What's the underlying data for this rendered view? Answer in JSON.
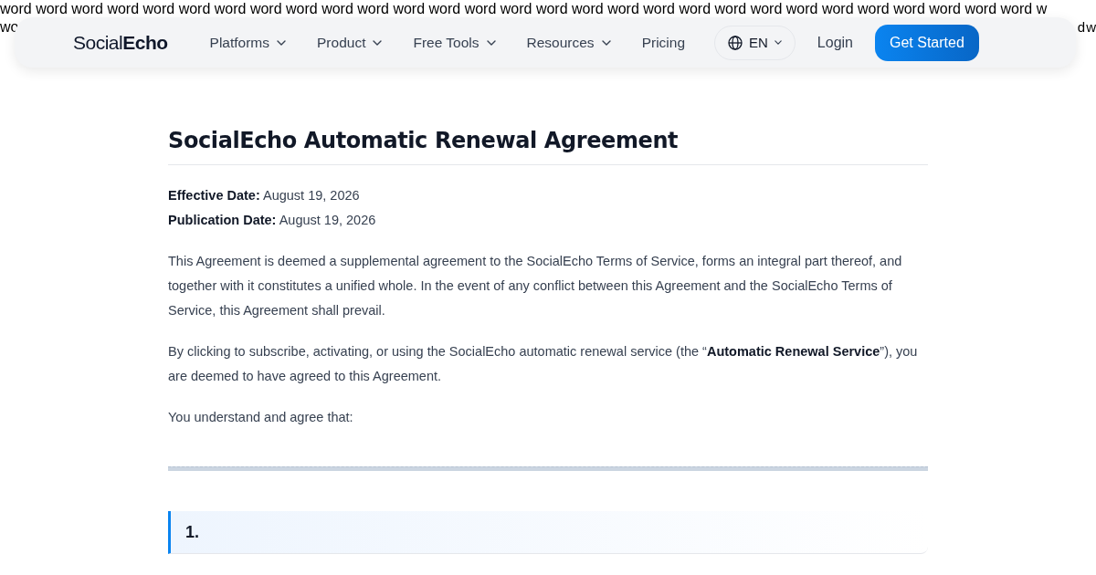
{
  "background_text": {
    "line_1": "word word word word word word word word word word word word word word word word word word word word word word word word word word word word word w",
    "line_2_left": "wo",
    "line_2_right": "d w"
  },
  "header": {
    "logo": "Social**Echo**",
    "nav": [
      {
        "label": "Platforms",
        "dropdown": true
      },
      {
        "label": "Product",
        "dropdown": true
      },
      {
        "label": "Free Tools",
        "dropdown": true
      },
      {
        "label": "Resources",
        "dropdown": true
      },
      {
        "label": "Pricing",
        "dropdown": false
      }
    ],
    "language": "EN",
    "login": "Login",
    "cta": "Get Started"
  },
  "document": {
    "title": "SocialEcho Automatic Renewal Agreement",
    "meta": [
      "**Effective Date:** August 19, 2026",
      "**Publication Date:** August 19, 2026"
    ],
    "paragraphs": [
      "This Agreement is deemed a supplemental agreement to the SocialEcho Terms of Service, forms an integral part thereof, and together with it constitutes a unified whole. In the event of any conflict between this Agreement and the SocialEcho Terms of Service, this Agreement shall prevail.",
      "By clicking to subscribe, activating, or using the SocialEcho automatic renewal service (the “**Automatic Renewal Service**”), you are deemed to have agreed to this Agreement.",
      "You understand and agree that:"
    ],
    "section_heading": "1."
  }
}
